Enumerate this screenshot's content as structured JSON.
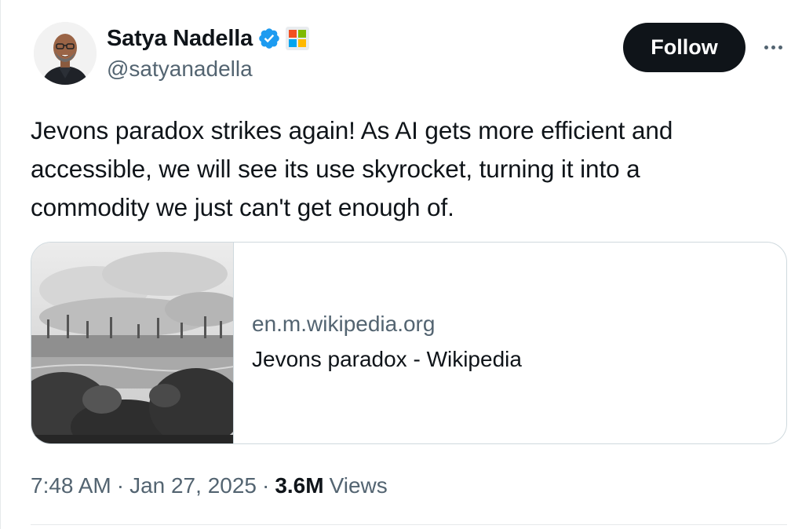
{
  "author": {
    "display_name": "Satya Nadella",
    "handle": "@satyanadella",
    "verified_icon": "verified-badge-icon",
    "affiliation_icon": "microsoft-affiliate-badge-icon",
    "avatar": "avatar"
  },
  "actions": {
    "follow_label": "Follow",
    "more_icon": "more-options-icon"
  },
  "tweet": {
    "line1": "Jevons paradox strikes again! As AI gets more efficient and",
    "line2": "accessible, we will see its use skyrocket, turning it into a",
    "line3": "commodity we just can't get enough of."
  },
  "link_card": {
    "domain": "en.m.wikipedia.org",
    "title": "Jevons paradox - Wikipedia",
    "image": "industrial-landscape-engraving"
  },
  "meta": {
    "time": "7:48 AM",
    "separator": "·",
    "date": "Jan 27, 2025",
    "views_count": "3.6M",
    "views_label": "Views"
  },
  "colors": {
    "text_primary": "#0f1419",
    "text_secondary": "#536471",
    "border": "#cfd9de",
    "verified_blue": "#1d9bf0",
    "follow_bg": "#0f1419"
  }
}
